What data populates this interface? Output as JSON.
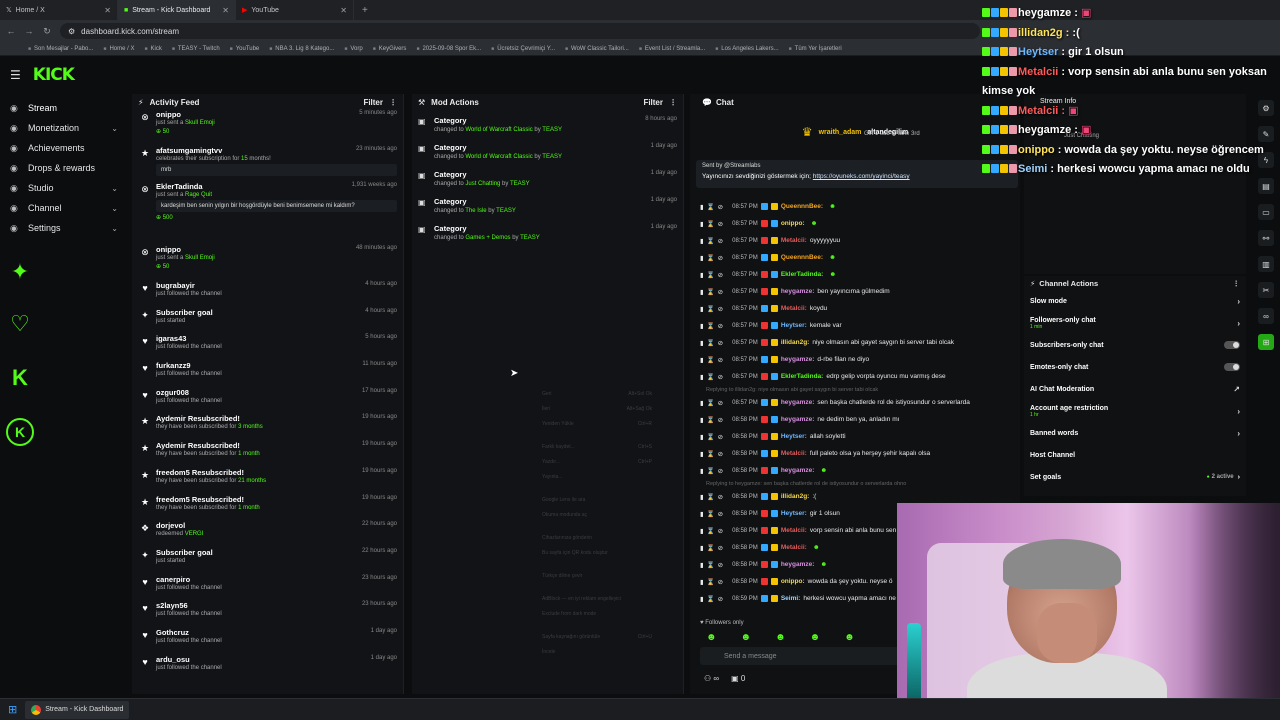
{
  "browser": {
    "tabs": [
      {
        "label": "Home / X",
        "active": false
      },
      {
        "label": "Stream - Kick Dashboard",
        "active": true
      },
      {
        "label": "YouTube",
        "active": false
      }
    ],
    "url": "dashboard.kick.com/stream",
    "bookmarks": [
      "Son Mesajlar - Pabo...",
      "Home / X",
      "Kick",
      "TEASY - Twitch",
      "YouTube",
      "NBA 3. Lig 8 Katego...",
      "Vorp",
      "KeyGivers",
      "2025-09-08 Spor Ek...",
      "Ücretsiz Çevrimiçi Y...",
      "WoW Classic Tailori...",
      "Event List / Streamla...",
      "Los Angeles Lakers...",
      "Tüm Yer İşaretleri"
    ]
  },
  "header": {
    "logo": "KICK"
  },
  "nav": [
    {
      "label": "Stream",
      "icon": "broadcast-icon",
      "chevron": false
    },
    {
      "label": "Monetization",
      "icon": "dollar-icon",
      "chevron": true
    },
    {
      "label": "Achievements",
      "icon": "trophy-icon",
      "chevron": false
    },
    {
      "label": "Drops & rewards",
      "icon": "gift-icon",
      "chevron": false
    },
    {
      "label": "Studio",
      "icon": "studio-icon",
      "chevron": true
    },
    {
      "label": "Channel",
      "icon": "channel-icon",
      "chevron": true
    },
    {
      "label": "Settings",
      "icon": "gear-icon",
      "chevron": true
    }
  ],
  "activity_feed": {
    "title": "Activity Feed",
    "filter": "Filter",
    "items": [
      {
        "name": "onippo",
        "time": "5 minutes ago",
        "sub": "just sent a ",
        "subg": "Skull Emoji",
        "extra": "50"
      },
      {
        "name": "afatsumgamingtvv",
        "time": "23 minutes ago",
        "sub": "celebrates their subscription for ",
        "subg": "15",
        "sub2": " months!",
        "msg": "mrb"
      },
      {
        "name": "EklerTadinda",
        "time": "1,931 weeks ago",
        "sub": "just sent a ",
        "subg": "Rage Quit",
        "msg": "kardeşim ben senin yılgın bir hoşgördüyle beni benimsemene mi kaldım?",
        "extra": "500"
      },
      {
        "name": "onippo",
        "time": "48 minutes ago",
        "sub": "just sent a ",
        "subg": "Skull Emoji",
        "extra": "50"
      },
      {
        "name": "bugrabayir",
        "time": "4 hours ago",
        "sub": "just followed the channel"
      },
      {
        "name": "Subscriber goal",
        "time": "4 hours ago",
        "sub": "just started"
      },
      {
        "name": "igaras43",
        "time": "5 hours ago",
        "sub": "just followed the channel"
      },
      {
        "name": "furkanzz9",
        "time": "11 hours ago",
        "sub": "just followed the channel"
      },
      {
        "name": "ozgur008",
        "time": "17 hours ago",
        "sub": "just followed the channel"
      },
      {
        "name": "Aydemir Resubscribed!",
        "time": "19 hours ago",
        "sub": "they have been subscribed for ",
        "subg": "3 months"
      },
      {
        "name": "Aydemir Resubscribed!",
        "time": "19 hours ago",
        "sub": "they have been subscribed for ",
        "subg": "1 month"
      },
      {
        "name": "freedom5 Resubscribed!",
        "time": "19 hours ago",
        "sub": "they have been subscribed for ",
        "subg": "21 months"
      },
      {
        "name": "freedom5 Resubscribed!",
        "time": "19 hours ago",
        "sub": "they have been subscribed for ",
        "subg": "1 month"
      },
      {
        "name": "dorjevol",
        "time": "22 hours ago",
        "sub": "redeemed ",
        "subg": "VERGI"
      },
      {
        "name": "Subscriber goal",
        "time": "22 hours ago",
        "sub": "just started"
      },
      {
        "name": "canerpiro",
        "time": "23 hours ago",
        "sub": "just followed the channel"
      },
      {
        "name": "s2layn56",
        "time": "23 hours ago",
        "sub": "just followed the channel"
      },
      {
        "name": "Gothcruz",
        "time": "1 day ago",
        "sub": "just followed the channel"
      },
      {
        "name": "ardu_osu",
        "time": "1 day ago",
        "sub": "just followed the channel"
      }
    ]
  },
  "mod_actions": {
    "title": "Mod Actions",
    "filter": "Filter",
    "items": [
      {
        "title": "Category",
        "time": "8 hours ago",
        "changed": "changed to ",
        "game": "World of Warcraft Classic",
        "by": " by ",
        "user": "TEASY"
      },
      {
        "title": "Category",
        "time": "1 day ago",
        "changed": "changed to ",
        "game": "World of Warcraft Classic",
        "by": " by ",
        "user": "TEASY"
      },
      {
        "title": "Category",
        "time": "1 day ago",
        "changed": "changed to ",
        "game": "Just Chatting",
        "by": " by ",
        "user": "TEASY"
      },
      {
        "title": "Category",
        "time": "1 day ago",
        "changed": "changed to ",
        "game": "The Isle",
        "by": " by ",
        "user": "TEASY"
      },
      {
        "title": "Category",
        "time": "1 day ago",
        "changed": "changed to ",
        "game": "Games + Demos",
        "by": " by ",
        "user": "TEASY"
      }
    ]
  },
  "context_menu": [
    {
      "label": "Geri",
      "sc": "Alt+Sol Ok"
    },
    {
      "label": "İleri",
      "sc": "Alt+Sağ Ok"
    },
    {
      "label": "Yeniden Yükle",
      "sc": "Ctrl+R"
    },
    {
      "label": "Farklı kaydet...",
      "sc": "Ctrl+S"
    },
    {
      "label": "Yazdır...",
      "sc": "Ctrl+P"
    },
    {
      "label": "Yayınla...",
      "sc": ""
    },
    {
      "label": "Google Lens ile ara",
      "sc": ""
    },
    {
      "label": "Okuma modunda aç",
      "sc": ""
    },
    {
      "label": "Cihazlarınıza gönderin",
      "sc": ""
    },
    {
      "label": "Bu sayfa için QR kodu oluştur",
      "sc": ""
    },
    {
      "label": "Türkçe diline çevir",
      "sc": ""
    },
    {
      "label": "AdBlock — en iyi reklam engelleyici",
      "sc": ""
    },
    {
      "label": "Exclude from dark mode",
      "sc": ""
    },
    {
      "label": "Sayfa kaynağını görüntüle",
      "sc": "Ctrl+U"
    },
    {
      "label": "İncele",
      "sc": ""
    }
  ],
  "chat": {
    "title": "Chat",
    "pinned": {
      "user": "wraith_adam",
      "user2": "altandegilim",
      "text": "Gift 1 sub to take 3rd"
    },
    "streamlabs_sender": "Sent by  @Streamlabs",
    "streamlabs_msg": "Yayıncınızı sevdiğinizi göstermek için; ",
    "streamlabs_link": "https://oyuneks.com/yayinci/teasy",
    "lines": [
      {
        "time": "08:57 PM",
        "name": "QueennnBee:",
        "color": "#f5a623",
        "text": ""
      },
      {
        "time": "08:57 PM",
        "name": "onippo:",
        "color": "#f5d94a",
        "text": ""
      },
      {
        "time": "08:57 PM",
        "name": "Metalcii:",
        "color": "#e35b5b",
        "text": "oyyyyyyuu"
      },
      {
        "time": "08:57 PM",
        "name": "QueennnBee:",
        "color": "#f5a623",
        "text": ""
      },
      {
        "time": "08:57 PM",
        "name": "EklerTadinda:",
        "color": "#53fc18",
        "text": ""
      },
      {
        "time": "08:57 PM",
        "name": "heygamze:",
        "color": "#d98de0",
        "text": "ben yayıncıma gülmedim"
      },
      {
        "time": "08:57 PM",
        "name": "Metalcii:",
        "color": "#e35b5b",
        "text": "koydu"
      },
      {
        "time": "08:57 PM",
        "name": "Heytser:",
        "color": "#6fb8ff",
        "text": "kemale var"
      },
      {
        "time": "08:57 PM",
        "name": "illidan2g:",
        "color": "#f5d94a",
        "text": "niye olmasın abi gayet saygın bi server tabi olcak"
      },
      {
        "time": "08:57 PM",
        "name": "heygamze:",
        "color": "#d98de0",
        "text": "d-rbe filan ne diyo"
      },
      {
        "time": "08:57 PM",
        "name": "EklerTadinda:",
        "color": "#53fc18",
        "text": "edrp gelip vorpta oyuncu mu varmış dese"
      },
      {
        "reply": "Replying to illidan2g: niye olmasın abi gayet saygın bi server tabi olcak"
      },
      {
        "time": "08:57 PM",
        "name": "heygamze:",
        "color": "#d98de0",
        "text": "sen başka chatlerde rol de istiyosundur o serverlarda"
      },
      {
        "time": "08:58 PM",
        "name": "heygamze:",
        "color": "#d98de0",
        "text": "ne dedim ben ya, anladın mı"
      },
      {
        "time": "08:58 PM",
        "name": "Heytser:",
        "color": "#6fb8ff",
        "text": "allah soyletti"
      },
      {
        "time": "08:58 PM",
        "name": "Metalcii:",
        "color": "#e35b5b",
        "text": "full paleto olsa ya herşey şehir kapalı olsa"
      },
      {
        "time": "08:58 PM",
        "name": "heygamze:",
        "color": "#d98de0",
        "text": ""
      },
      {
        "reply": "Replying to heygamze: sen başka chatlerde rol de istiyosundur o serverlarda ohno"
      },
      {
        "time": "08:58 PM",
        "name": "illidan2g:",
        "color": "#f5d94a",
        "text": ":("
      },
      {
        "time": "08:58 PM",
        "name": "Heytser:",
        "color": "#6fb8ff",
        "text": "gir 1 olsun"
      },
      {
        "time": "08:58 PM",
        "name": "Metalcii:",
        "color": "#e35b5b",
        "text": "vorp sensin abi anla bunu sen"
      },
      {
        "time": "08:58 PM",
        "name": "Metalcii:",
        "color": "#e35b5b",
        "text": ""
      },
      {
        "time": "08:58 PM",
        "name": "heygamze:",
        "color": "#d98de0",
        "text": ""
      },
      {
        "time": "08:58 PM",
        "name": "onippo:",
        "color": "#f5d94a",
        "text": "wowda da şey yoktu. neyse ö"
      },
      {
        "time": "08:59 PM",
        "name": "Seimi:",
        "color": "#9fd3ff",
        "text": "herkesi wowcu yapma amacı ne"
      }
    ],
    "followers_only": "Followers only",
    "send_placeholder": "Send a message",
    "count": "0"
  },
  "stream_info": {
    "title": "Stream Info",
    "subtitle": "Just Chatting"
  },
  "channel_actions": {
    "title": "Channel Actions",
    "rows": [
      {
        "label": "Slow mode",
        "kind": "chev"
      },
      {
        "label": "Followers-only chat",
        "sub": "1 min",
        "kind": "chev"
      },
      {
        "label": "Subscribers-only chat",
        "kind": "toggle"
      },
      {
        "label": "Emotes-only chat",
        "kind": "toggle"
      },
      {
        "label": "AI Chat Moderation",
        "kind": "ext"
      },
      {
        "label": "Account age restriction",
        "sub": "1 hr",
        "kind": "chev"
      },
      {
        "label": "Banned words",
        "kind": "chev"
      },
      {
        "label": "Host Channel",
        "kind": "none"
      },
      {
        "label": "Set goals",
        "badge": "2 active",
        "kind": "chev"
      }
    ]
  },
  "overlay": [
    {
      "name": "heygamze :",
      "color": "#ffffff",
      "text": ""
    },
    {
      "name": "illidan2g :",
      "color": "#ffe45a",
      "text": " :("
    },
    {
      "name": "Heytser",
      "color": "#6fb8ff",
      "text": " : gir 1 olsun"
    },
    {
      "name": "Metalcii",
      "color": "#ff5a5a",
      "text": " : vorp sensin abi anla bunu sen yoksan kimse yok"
    },
    {
      "name": "Metalcii :",
      "color": "#ff5a5a",
      "text": ""
    },
    {
      "name": "heygamze :",
      "color": "#ffffff",
      "text": ""
    },
    {
      "name": "onippo",
      "color": "#ffe45a",
      "text": " : wowda da şey yoktu. neyse öğrencem"
    },
    {
      "name": "Seimi",
      "color": "#9fd3ff",
      "text": " : herkesi wowcu yapma amacı ne oldu"
    }
  ],
  "taskbar": {
    "app": "Stream - Kick Dashboard"
  }
}
